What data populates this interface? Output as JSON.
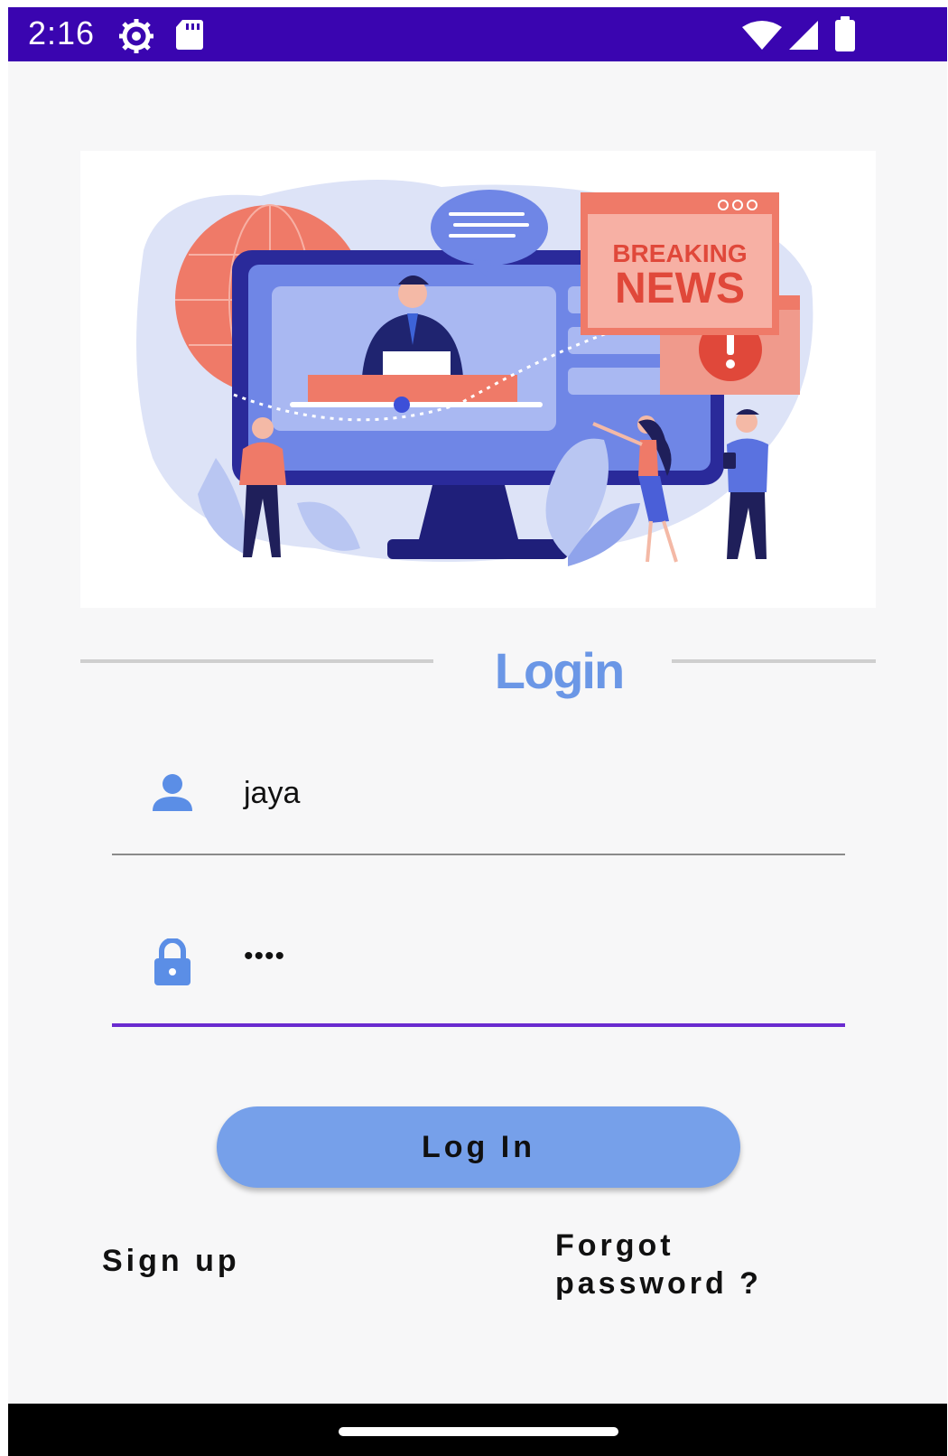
{
  "status_bar": {
    "time": "2:16",
    "icons": [
      "settings-gear-icon",
      "sd-card-icon",
      "wifi-icon",
      "cell-signal-icon",
      "battery-icon"
    ],
    "background": "#3a05b0"
  },
  "hero": {
    "banner_line1": "BREAKING",
    "banner_line2": "NEWS"
  },
  "login": {
    "title": "Login",
    "title_color": "#6b97e6",
    "username_value": "jaya",
    "password_value": "••••",
    "button_label": "Log In",
    "button_color": "#76a0ea",
    "focus_color": "#6a2bd0"
  },
  "links": {
    "signup": "Sign up",
    "forgot_line1": "Forgot",
    "forgot_line2": "password ?"
  }
}
